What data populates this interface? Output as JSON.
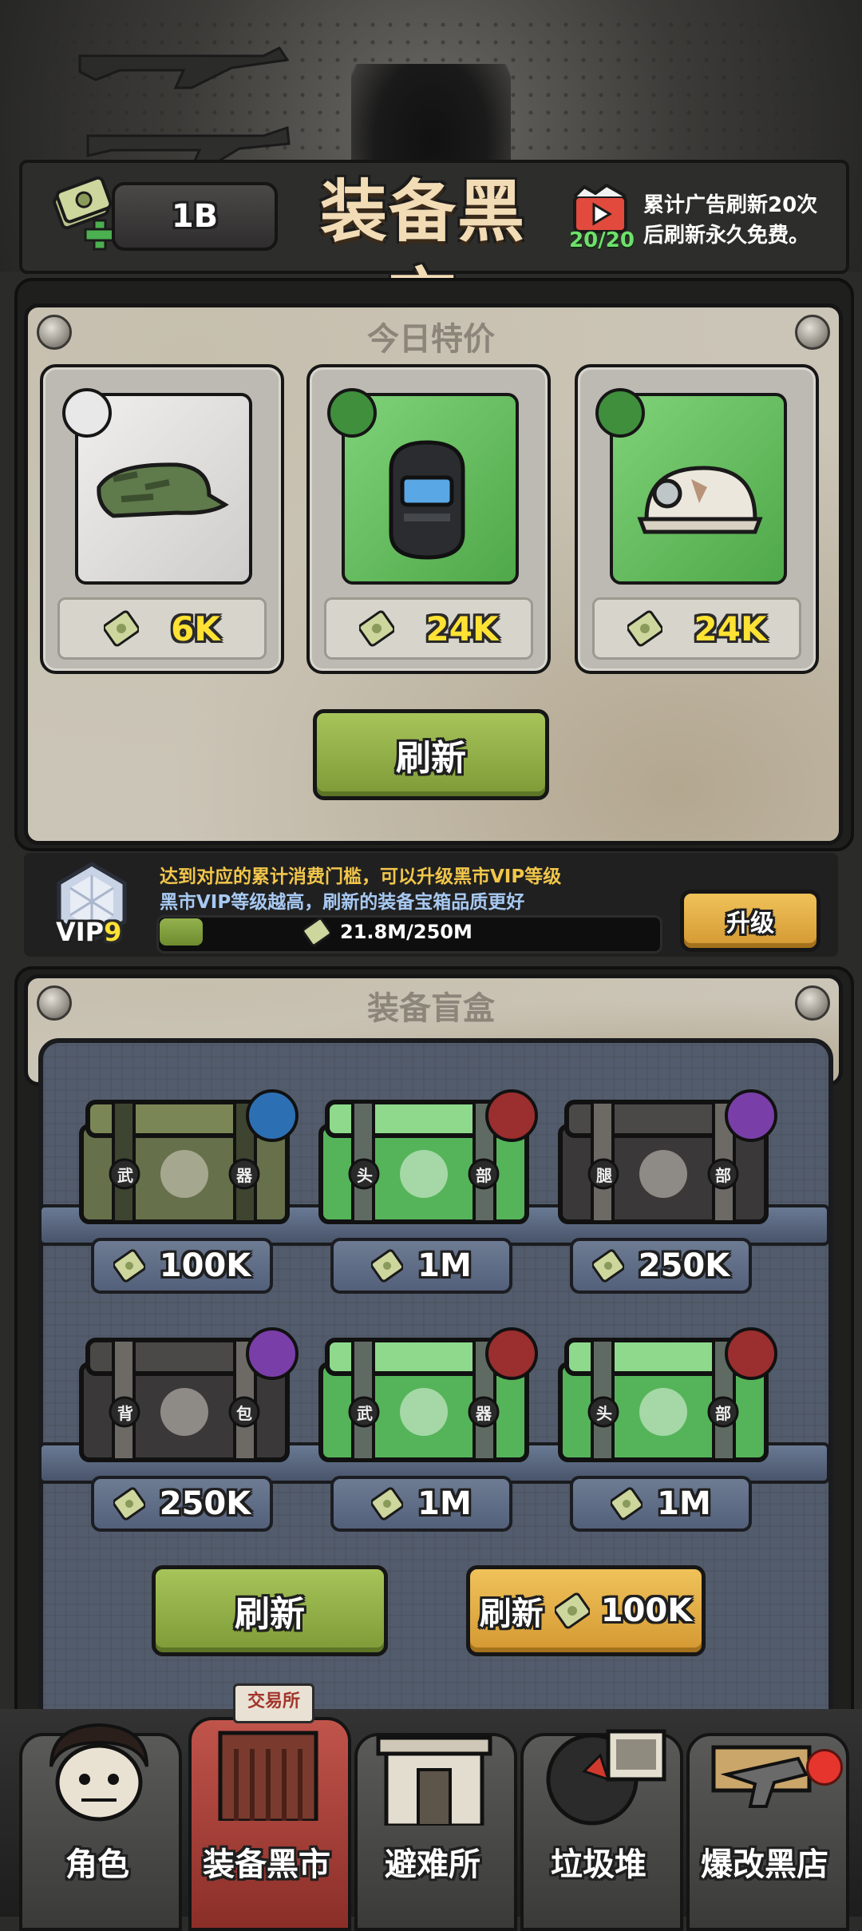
{
  "header": {
    "cash": "1B",
    "title": "装备黑市",
    "ad_count": "20/20",
    "ad_note_line1": "累计广告刷新20次",
    "ad_note_line2": "后刷新永久免费。"
  },
  "daily": {
    "title": "今日特价",
    "items": [
      {
        "icon": "military-cap",
        "slot_icon": "helmet-slot-icon",
        "price": "6K",
        "rarity_color": "#d7d5d2"
      },
      {
        "icon": "welding-mask",
        "slot_icon": "mask-slot-icon",
        "price": "24K",
        "rarity_color": "#6cbf63"
      },
      {
        "icon": "miner-helmet",
        "slot_icon": "helmet-slot-icon",
        "price": "24K",
        "rarity_color": "#6cbf63"
      }
    ],
    "refresh_label": "刷新"
  },
  "vip": {
    "level_label": "VIP",
    "level": "9",
    "line1": "达到对应的累计消费门槛，可以升级黑市VIP等级",
    "line2": "黑市VIP等级越高，刷新的装备宝箱品质更好",
    "progress_text": "21.8M/250M",
    "progress_fraction": 0.087,
    "upgrade_label": "升级"
  },
  "blind": {
    "title": "装备盲盒",
    "boxes": [
      {
        "kind": "weapon",
        "style": "military",
        "left": "武",
        "right": "器",
        "price": "100K",
        "badge_color": "#2d6fb3"
      },
      {
        "kind": "helmet",
        "style": "emerald",
        "left": "头",
        "right": "部",
        "price": "1M",
        "badge_color": "#9b2e2e"
      },
      {
        "kind": "pants",
        "style": "dark",
        "left": "腿",
        "right": "部",
        "price": "250K",
        "badge_color": "#7a3ea8"
      },
      {
        "kind": "backpack",
        "style": "dark",
        "left": "背",
        "right": "包",
        "price": "250K",
        "badge_color": "#7a3ea8"
      },
      {
        "kind": "weapon",
        "style": "emerald",
        "left": "武",
        "right": "器",
        "price": "1M",
        "badge_color": "#9b2e2e"
      },
      {
        "kind": "helmet",
        "style": "emerald",
        "left": "头",
        "right": "部",
        "price": "1M",
        "badge_color": "#9b2e2e"
      }
    ],
    "refresh_free_label": "刷新",
    "refresh_paid_label": "刷新",
    "refresh_paid_price": "100K"
  },
  "nav": {
    "tabs": [
      {
        "label": "角色"
      },
      {
        "label": "装备黑市"
      },
      {
        "label": "避难所"
      },
      {
        "label": "垃圾堆"
      },
      {
        "label": "爆改黑店"
      }
    ],
    "exchange_tag": "交易所"
  }
}
